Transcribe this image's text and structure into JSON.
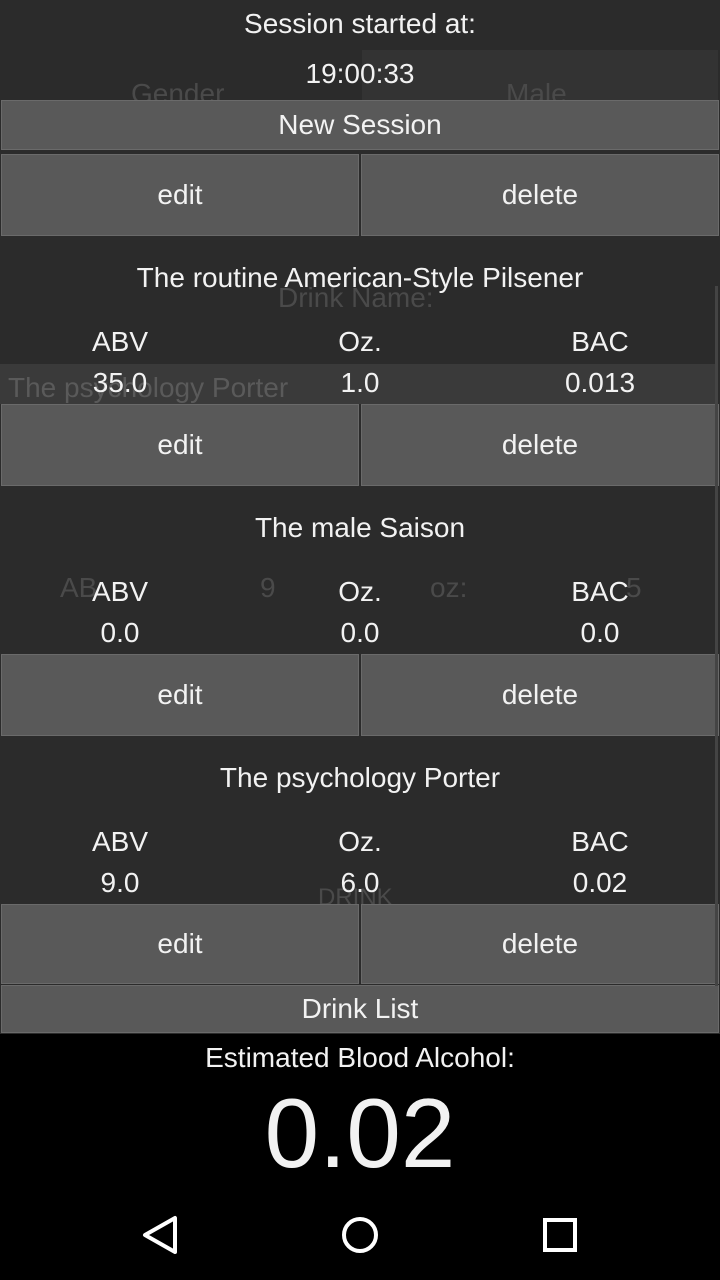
{
  "session": {
    "started_label": "Session started at:",
    "started_time": "19:00:33",
    "new_session_label": "New Session"
  },
  "top_actions": {
    "edit_label": "edit",
    "delete_label": "delete"
  },
  "drinks": [
    {
      "name": "The routine American-Style Pilsener",
      "abv_label": "ABV",
      "oz_label": "Oz.",
      "bac_label": "BAC",
      "abv": "35.0",
      "oz": "1.0",
      "bac": "0.013",
      "edit_label": "edit",
      "delete_label": "delete"
    },
    {
      "name": "The male Saison",
      "abv_label": "ABV",
      "oz_label": "Oz.",
      "bac_label": "BAC",
      "abv": "0.0",
      "oz": "0.0",
      "bac": "0.0",
      "edit_label": "edit",
      "delete_label": "delete"
    },
    {
      "name": "The psychology Porter",
      "abv_label": "ABV",
      "oz_label": "Oz.",
      "bac_label": "BAC",
      "abv": "9.0",
      "oz": "6.0",
      "bac": "0.02",
      "edit_label": "edit",
      "delete_label": "delete"
    }
  ],
  "drink_list_label": "Drink List",
  "estimate": {
    "label": "Estimated Blood Alcohol:",
    "value": "0.02"
  },
  "background": {
    "gender_label": "Gender",
    "gender_value": "Male",
    "drink_name_label": "Drink Name:",
    "drink_name_value": "The psychology Porter",
    "abv_label": "AB",
    "abv_value": "9",
    "oz_label": "oz:",
    "oz_value": "5",
    "drink_button": "DRINK"
  },
  "nav": {
    "back_icon": "back-triangle-icon",
    "home_icon": "home-circle-icon",
    "recents_icon": "recents-square-icon"
  }
}
